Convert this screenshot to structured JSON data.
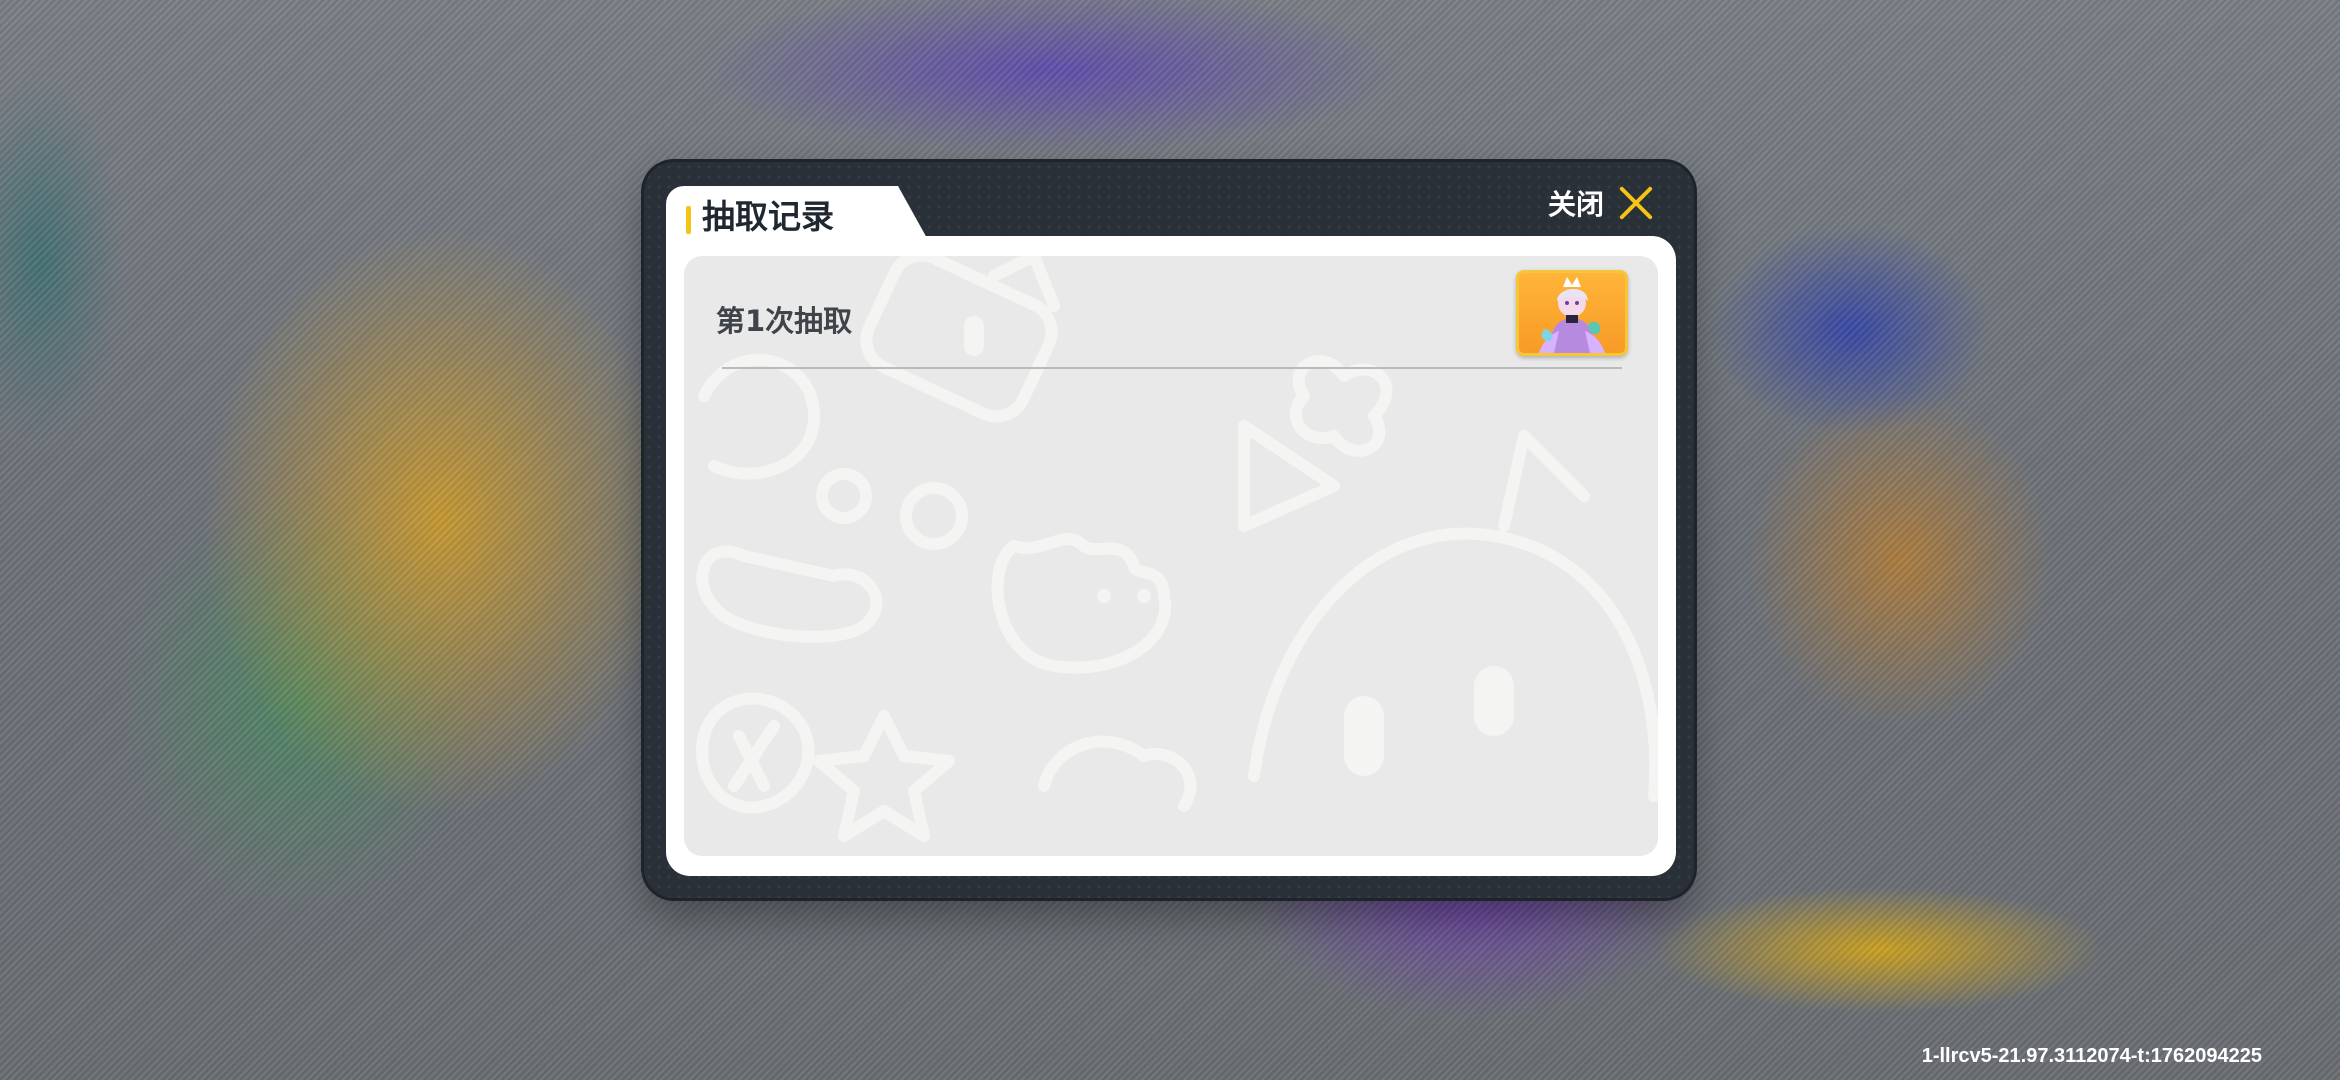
{
  "dialog": {
    "title": "抽取记录",
    "close_label": "关闭"
  },
  "records": [
    {
      "label": "第1次抽取",
      "reward_icon": "character-portrait-thumbnail"
    }
  ],
  "watermark": "1-llrcv5-21.97.3112074-t:1762094225",
  "colors": {
    "accent": "#f5c516",
    "dialog_frame": "#2a3038",
    "panel": "#e8e9e8",
    "thumb_bg": "#f79b26"
  }
}
